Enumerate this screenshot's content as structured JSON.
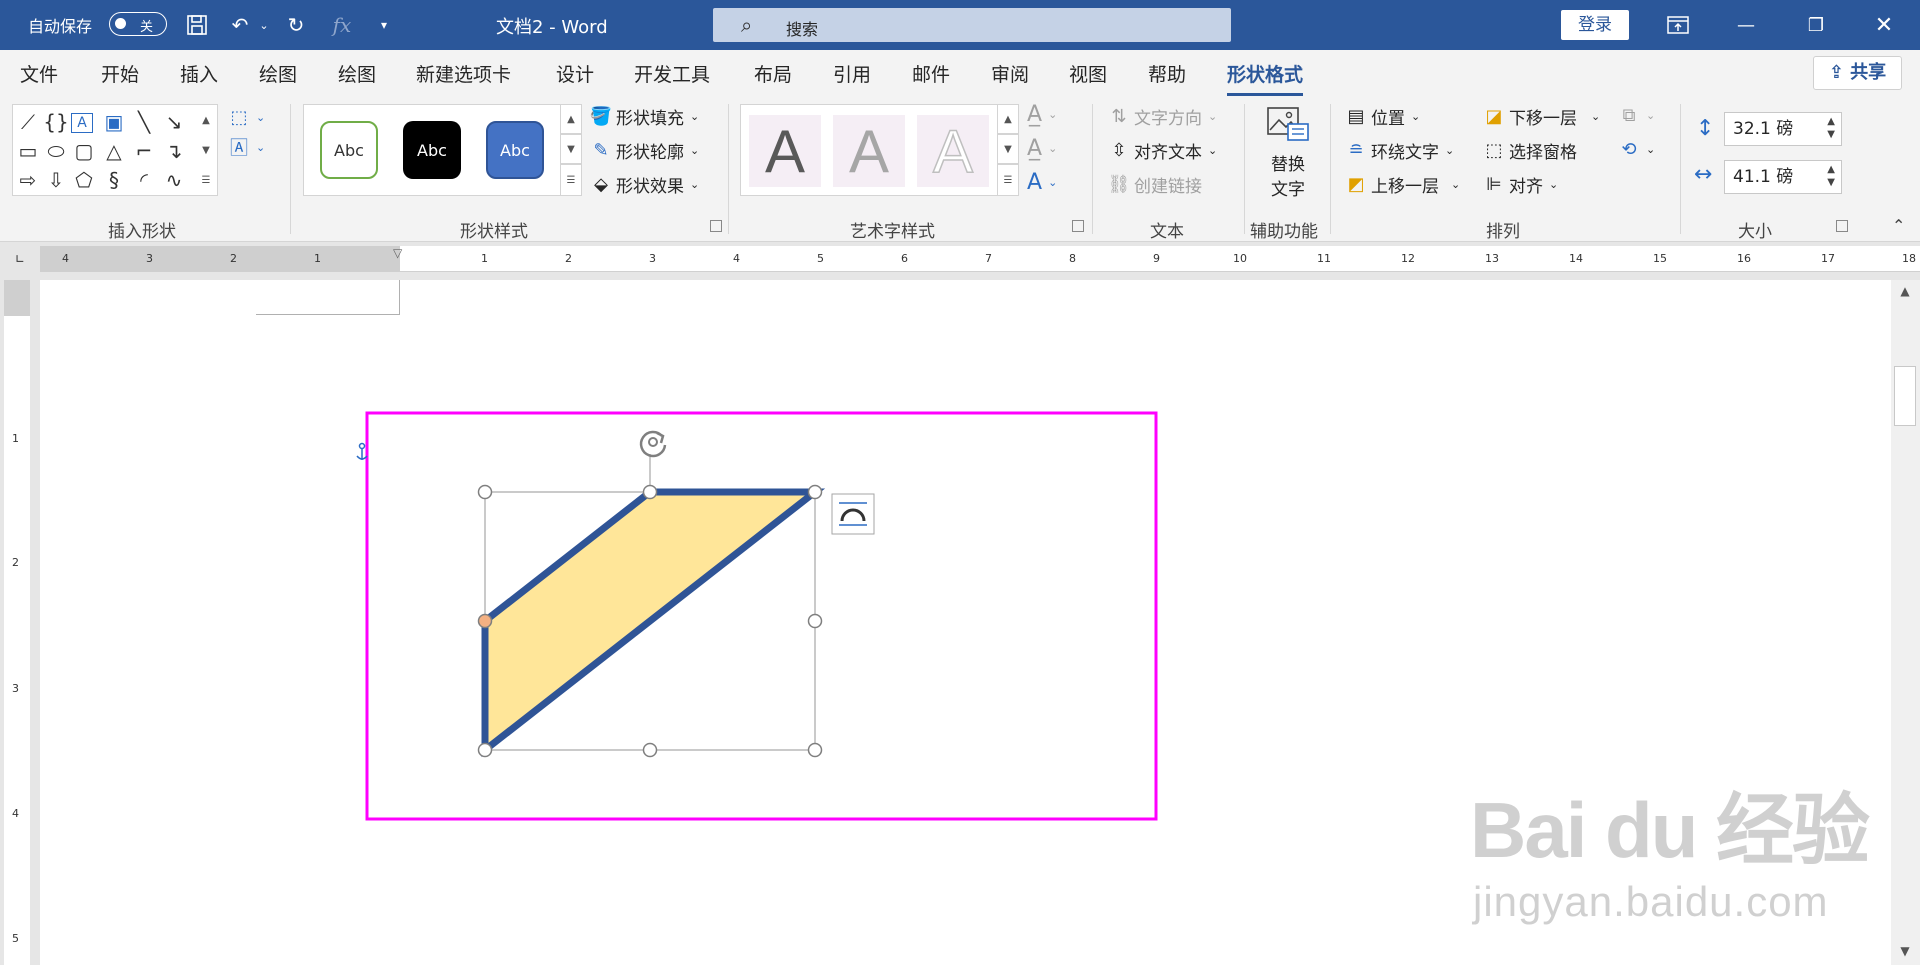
{
  "titlebar": {
    "autosave_label": "自动保存",
    "autosave_state": "关",
    "doc_title": "文档2  -  Word",
    "search_placeholder": "搜索",
    "signin_label": "登录"
  },
  "tabs": [
    "文件",
    "开始",
    "插入",
    "绘图",
    "绘图",
    "新建选项卡",
    "设计",
    "开发工具",
    "布局",
    "引用",
    "邮件",
    "审阅",
    "视图",
    "帮助",
    "形状格式"
  ],
  "active_tab": "形状格式",
  "share_label": "共享",
  "ribbon": {
    "insert_shapes": {
      "label": "插入形状"
    },
    "shape_styles": {
      "label": "形状样式",
      "presets": [
        "Abc",
        "Abc",
        "Abc"
      ],
      "fill": "形状填充",
      "outline": "形状轮廓",
      "effects": "形状效果"
    },
    "wordart": {
      "label": "艺术字样式",
      "letters": [
        "A",
        "A",
        "A"
      ]
    },
    "text": {
      "label": "文本",
      "direction": "文字方向",
      "align": "对齐文本",
      "link": "创建链接"
    },
    "accessibility": {
      "label": "辅助功能",
      "alt_text_1": "替换",
      "alt_text_2": "文字"
    },
    "arrange": {
      "label": "排列",
      "position": "位置",
      "wrap": "环绕文字",
      "forward": "上移一层",
      "backward": "下移一层",
      "selection_pane": "选择窗格",
      "align": "对齐"
    },
    "size": {
      "label": "大小",
      "height": "32.1 磅",
      "width": "41.1 磅"
    }
  },
  "ruler": {
    "left_numbers": [
      "4",
      "3",
      "2",
      "1"
    ],
    "right_numbers": [
      "1",
      "2",
      "3",
      "4",
      "5",
      "6",
      "7",
      "8",
      "9",
      "10",
      "11",
      "12",
      "13",
      "14",
      "15",
      "16",
      "17",
      "18"
    ],
    "vertical_numbers": [
      "1",
      "2",
      "3",
      "4",
      "5"
    ]
  },
  "watermark": {
    "logo": "Bai du 经验",
    "url": "jingyan.baidu.com"
  },
  "colors": {
    "accent": "#2b579a",
    "shape_fill": "#ffe699",
    "shape_outline": "#2f5496",
    "highlight_box": "#ff00ff",
    "handle_yellow": "#f4b183"
  }
}
